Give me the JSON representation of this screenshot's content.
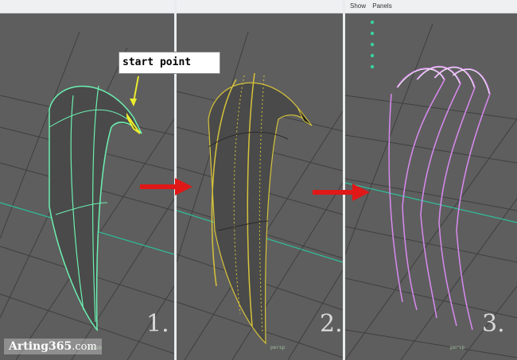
{
  "panel3_menu": [
    "Show",
    "Panels"
  ],
  "callout_label": "start point",
  "step_labels": [
    "1.",
    "2.",
    "3."
  ],
  "camera_label": "persp",
  "watermark": {
    "brand": "Arting365",
    "suffix": ".com"
  },
  "colors": {
    "viewport_bg": "#5e5e5e",
    "surface": "#4a4a4a",
    "edge_green": "#6cf0b0",
    "curve_yellow": "#d6c23a",
    "curve_magenta": "#d98af0",
    "arrow_red": "#e01818",
    "grid": "#3e3e3e",
    "grid_axis": "#35c8a8"
  }
}
